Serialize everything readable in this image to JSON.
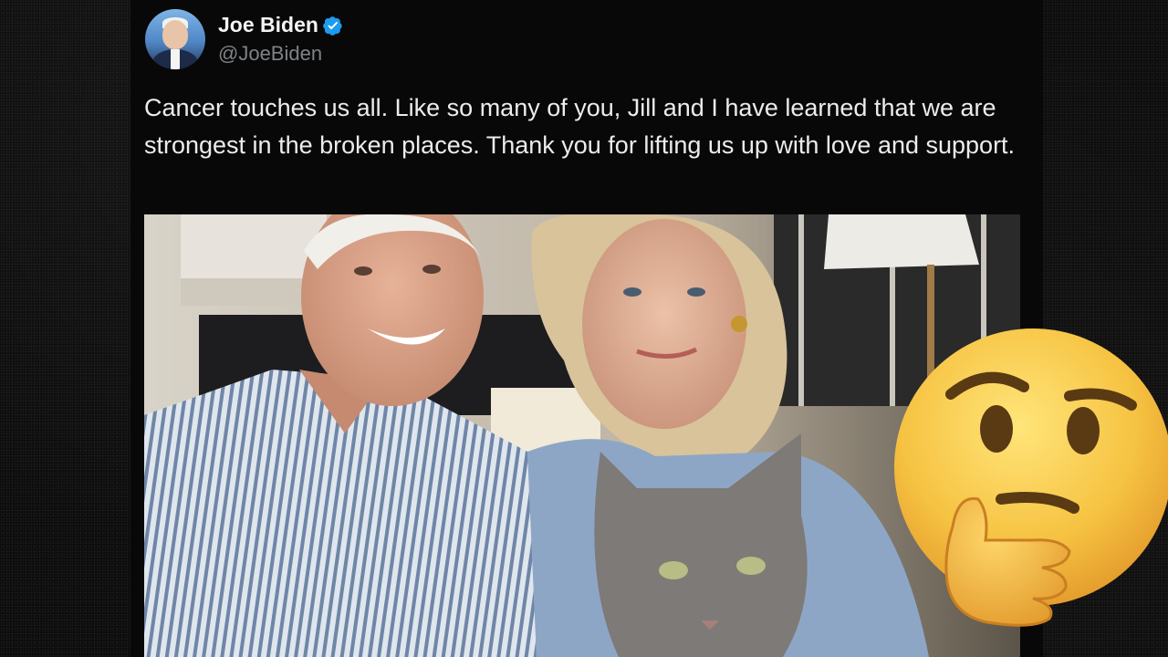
{
  "tweet": {
    "author": {
      "display_name": "Joe Biden",
      "handle": "@JoeBiden",
      "verified": true,
      "avatar_icon": "profile-photo"
    },
    "text": "Cancer touches us all. Like so many of you, Jill and I have learned that we are strongest in the broken places. Thank you for lifting us up with love and support.",
    "media": {
      "type": "photo",
      "subject_icon": "selfie-photo-with-cat"
    }
  },
  "overlay": {
    "emoji_icon": "thinking-face-emoji"
  },
  "colors": {
    "background": "#0c0c0c",
    "name": "#f4f4f4",
    "handle": "#7d8389",
    "text": "#ececec",
    "verified_badge": "#1d9bf0"
  }
}
